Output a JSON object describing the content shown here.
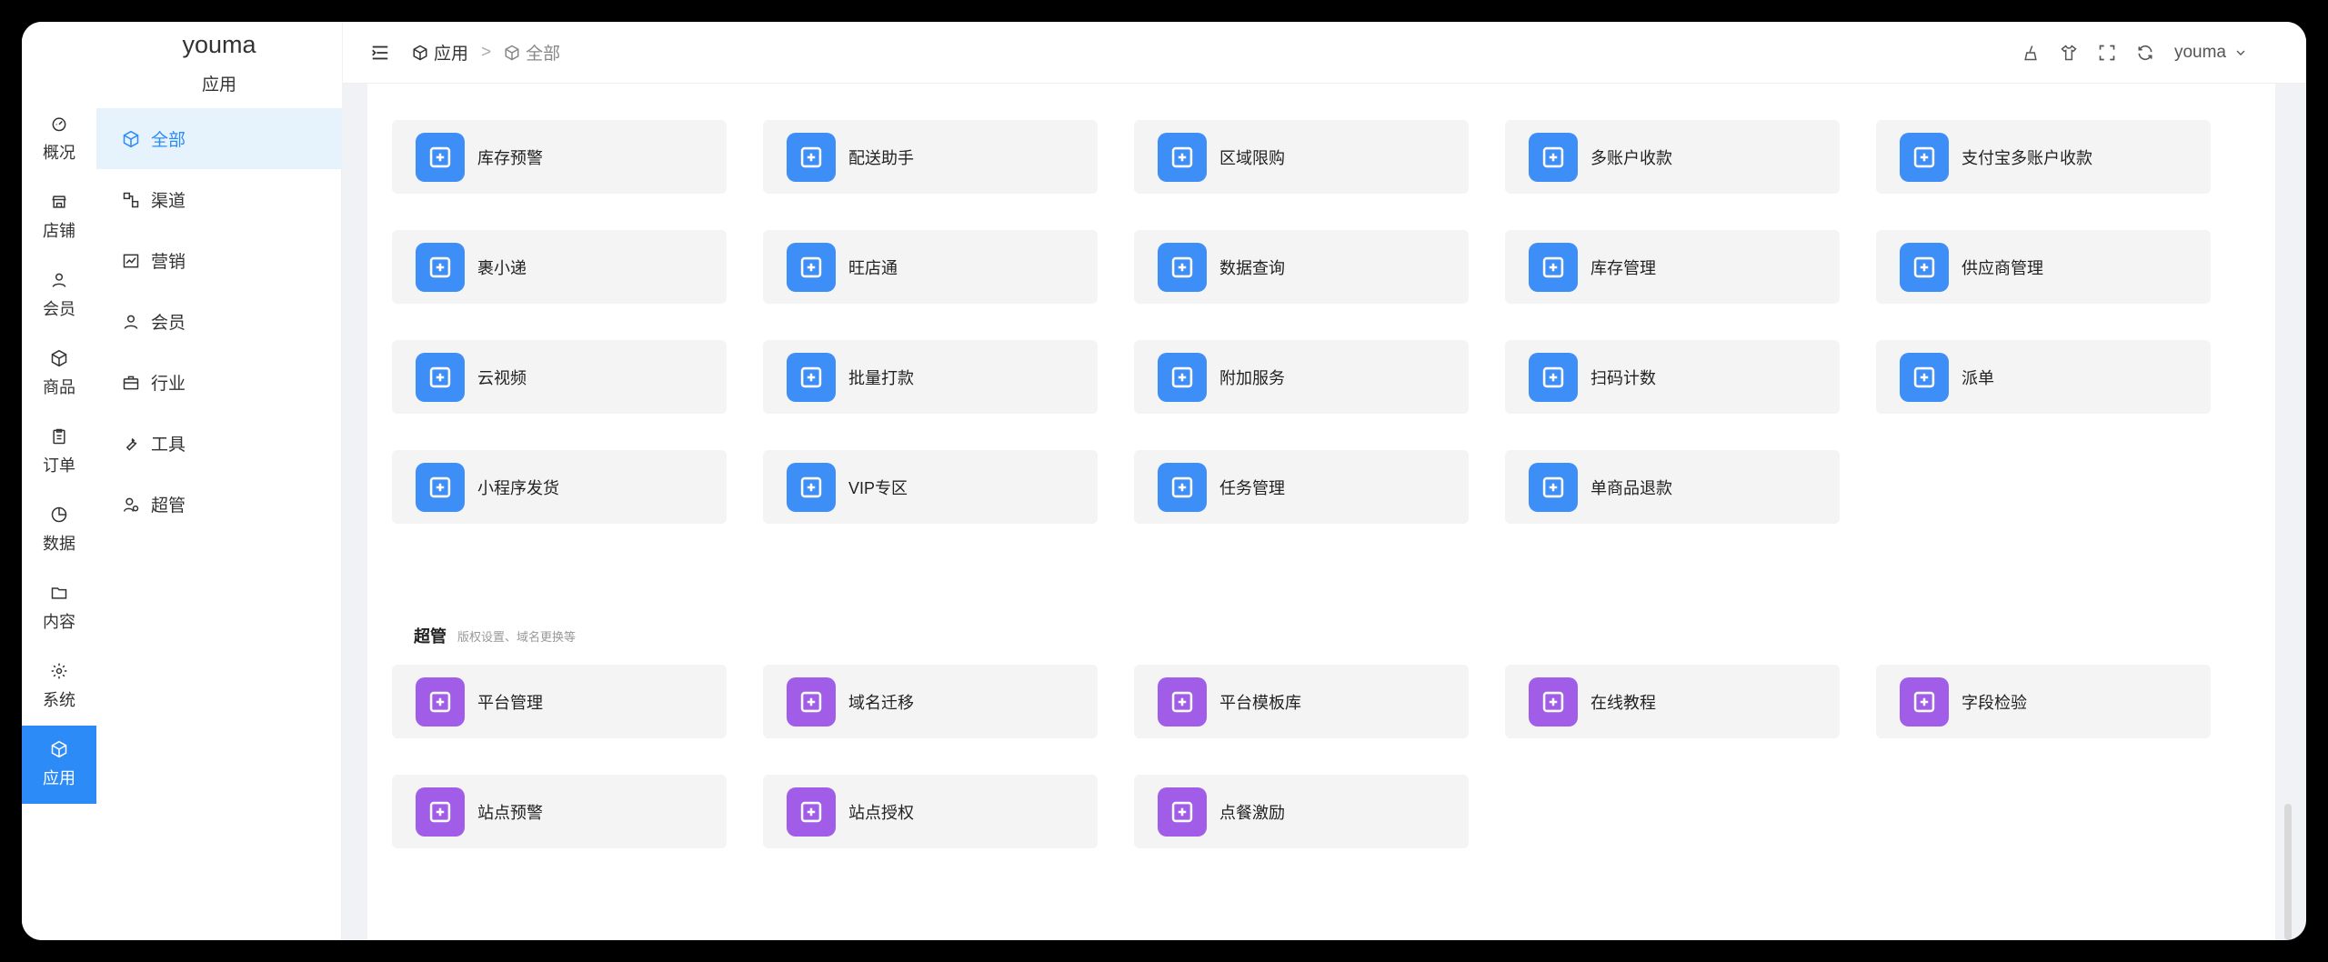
{
  "app": {
    "title": "youma",
    "subtitle": "应用"
  },
  "rail": [
    {
      "label": "概况",
      "icon": "dashboard-icon"
    },
    {
      "label": "店铺",
      "icon": "store-icon"
    },
    {
      "label": "会员",
      "icon": "user-icon"
    },
    {
      "label": "商品",
      "icon": "box-icon"
    },
    {
      "label": "订单",
      "icon": "clipboard-icon"
    },
    {
      "label": "数据",
      "icon": "pie-icon"
    },
    {
      "label": "内容",
      "icon": "folder-icon"
    },
    {
      "label": "系统",
      "icon": "gear-icon"
    },
    {
      "label": "应用",
      "icon": "cube-icon",
      "active": true
    }
  ],
  "subnav": [
    {
      "label": "全部",
      "icon": "cube-icon",
      "active": true
    },
    {
      "label": "渠道",
      "icon": "channel-icon"
    },
    {
      "label": "营销",
      "icon": "chart-line-icon"
    },
    {
      "label": "会员",
      "icon": "user-icon"
    },
    {
      "label": "行业",
      "icon": "briefcase-icon"
    },
    {
      "label": "工具",
      "icon": "wrench-icon"
    },
    {
      "label": "超管",
      "icon": "admin-icon"
    }
  ],
  "breadcrumb": {
    "root": "应用",
    "separator": ">",
    "current": "全部"
  },
  "header": {
    "username": "youma"
  },
  "apps_blue": [
    "库存预警",
    "配送助手",
    "区域限购",
    "多账户收款",
    "支付宝多账户收款",
    "裹小递",
    "旺店通",
    "数据查询",
    "库存管理",
    "供应商管理",
    "云视频",
    "批量打款",
    "附加服务",
    "扫码计数",
    "派单",
    "小程序发货",
    "VIP专区",
    "任务管理",
    "单商品退款"
  ],
  "section": {
    "title": "超管",
    "desc": "版权设置、域名更换等"
  },
  "apps_purple": [
    "平台管理",
    "域名迁移",
    "平台模板库",
    "在线教程",
    "字段检验",
    "站点预警",
    "站点授权",
    "点餐激励"
  ],
  "colors": {
    "accent": "#2c8bf7",
    "blue_icon": "#3e8ef7",
    "purple_icon": "#a15ce8"
  }
}
